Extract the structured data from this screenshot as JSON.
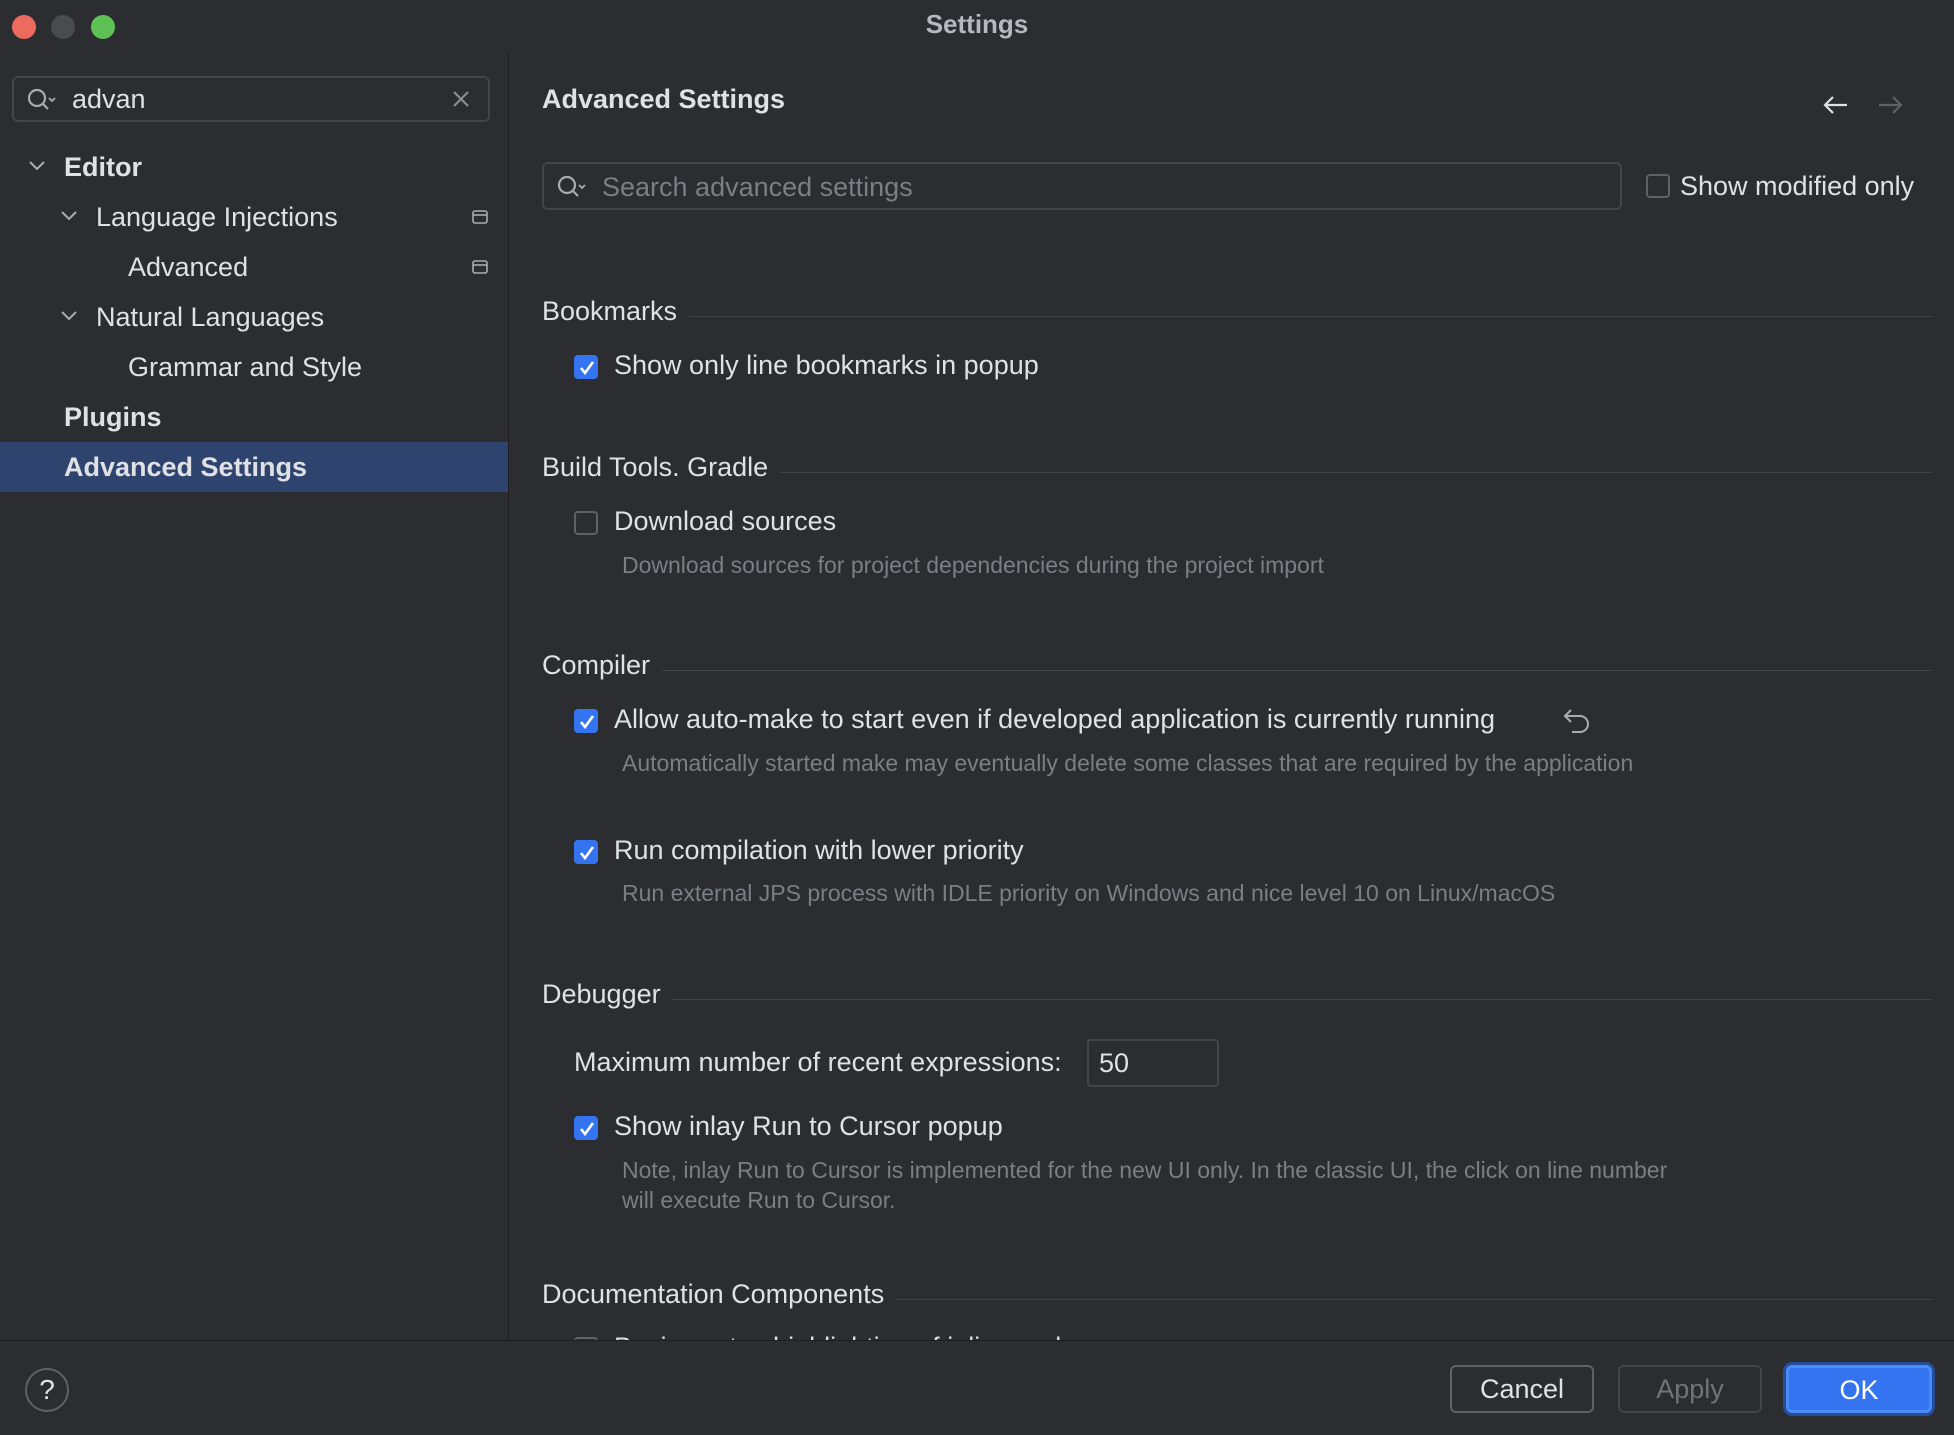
{
  "window": {
    "title": "Settings"
  },
  "sidebar": {
    "search_value": "advan",
    "items": [
      {
        "label": "Editor"
      },
      {
        "label": "Language Injections"
      },
      {
        "label": "Advanced"
      },
      {
        "label": "Natural Languages"
      },
      {
        "label": "Grammar and Style"
      },
      {
        "label": "Plugins"
      },
      {
        "label": "Advanced Settings"
      }
    ]
  },
  "main": {
    "title": "Advanced Settings",
    "search_placeholder": "Search advanced settings",
    "show_modified_label": "Show modified only",
    "sections": {
      "bookmarks": {
        "title": "Bookmarks",
        "opt1": "Show only line bookmarks in popup"
      },
      "gradle": {
        "title": "Build Tools. Gradle",
        "opt1": "Download sources",
        "opt1_desc": "Download sources for project dependencies during the project import"
      },
      "compiler": {
        "title": "Compiler",
        "opt1": "Allow auto-make to start even if developed application is currently running",
        "opt1_desc": "Automatically started make may eventually delete some classes that are required by the application",
        "opt2": "Run compilation with lower priority",
        "opt2_desc": "Run external JPS process with IDLE priority on Windows and nice level 10 on Linux/macOS"
      },
      "debugger": {
        "title": "Debugger",
        "max_label": "Maximum number of recent expressions:",
        "max_value": "50",
        "opt1": "Show inlay Run to Cursor popup",
        "opt1_desc": "Note, inlay Run to Cursor is implemented for the new UI only. In the classic UI, the click on line number will execute Run to Cursor."
      },
      "docs": {
        "title": "Documentation Components",
        "opt1": "Basic syntax highlighting of inline code"
      }
    }
  },
  "footer": {
    "help": "?",
    "cancel": "Cancel",
    "apply": "Apply",
    "ok": "OK"
  },
  "colors": {
    "background": "#2b2d30",
    "accent": "#3574f0",
    "selection": "#2e436e"
  }
}
